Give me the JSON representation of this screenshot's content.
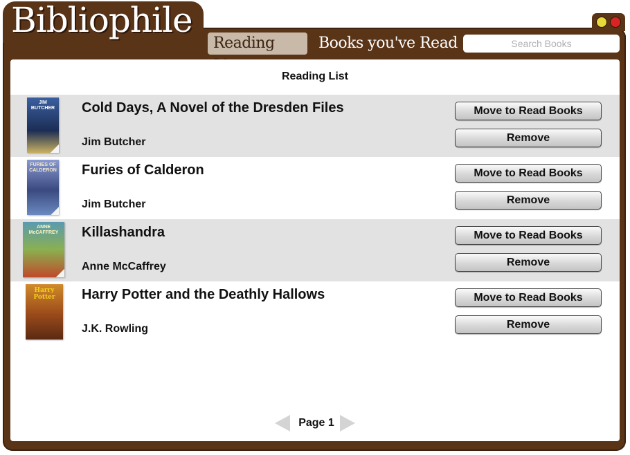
{
  "app": {
    "logo": "Bibliophile"
  },
  "nav": {
    "tabs": [
      {
        "label": "Reading List",
        "active": true
      },
      {
        "label": "Books you've Read",
        "active": false
      }
    ],
    "search_placeholder": "Search Books"
  },
  "main": {
    "title": "Reading List",
    "books": [
      {
        "title": "Cold Days, A Novel of the Dresden Files",
        "author": "Jim Butcher",
        "cover_text": "JIM BUTCHER"
      },
      {
        "title": "Furies of Calderon",
        "author": "Jim Butcher",
        "cover_text": "FURIES OF CALDERON"
      },
      {
        "title": "Killashandra",
        "author": "Anne McCaffrey",
        "cover_text": "ANNE McCAFFREY"
      },
      {
        "title": "Harry Potter and the Deathly Hallows",
        "author": "J.K. Rowling",
        "cover_text": "Harry Potter"
      }
    ],
    "move_label": "Move to Read Books",
    "remove_label": "Remove"
  },
  "pagination": {
    "label": "Page 1"
  },
  "colors": {
    "frame": "#5a3417",
    "active_tab": "#c9b9a8",
    "row_shade": "#e2e2e2",
    "covers": [
      "#2c4a7a",
      "#4a5a8c",
      "#7a9a3c",
      "#8a4a1c"
    ]
  }
}
